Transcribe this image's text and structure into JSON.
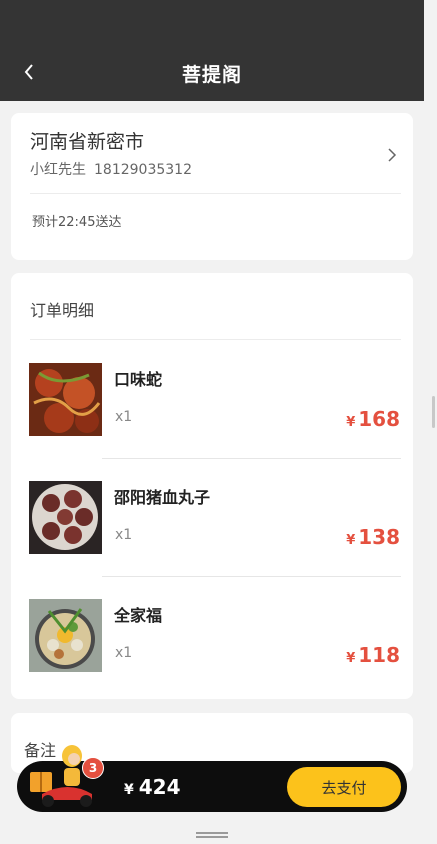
{
  "header": {
    "title": "菩提阁"
  },
  "address": {
    "main": "河南省新密市",
    "name": "小红先生",
    "phone": "18129035312",
    "eta": "预计22:45送达"
  },
  "order": {
    "title": "订单明细",
    "items": [
      {
        "name": "口味蛇",
        "qty": "x1",
        "currency": "¥",
        "price": "168"
      },
      {
        "name": "邵阳猪血丸子",
        "qty": "x1",
        "currency": "¥",
        "price": "138"
      },
      {
        "name": "全家福",
        "qty": "x1",
        "currency": "¥",
        "price": "118"
      }
    ]
  },
  "remark": {
    "title": "备注"
  },
  "paybar": {
    "cart_count": "3",
    "currency": "¥",
    "total": "424",
    "pay_label": "去支付"
  },
  "colors": {
    "accent": "#fcc21b",
    "price": "#e4503f",
    "header": "#343434"
  }
}
